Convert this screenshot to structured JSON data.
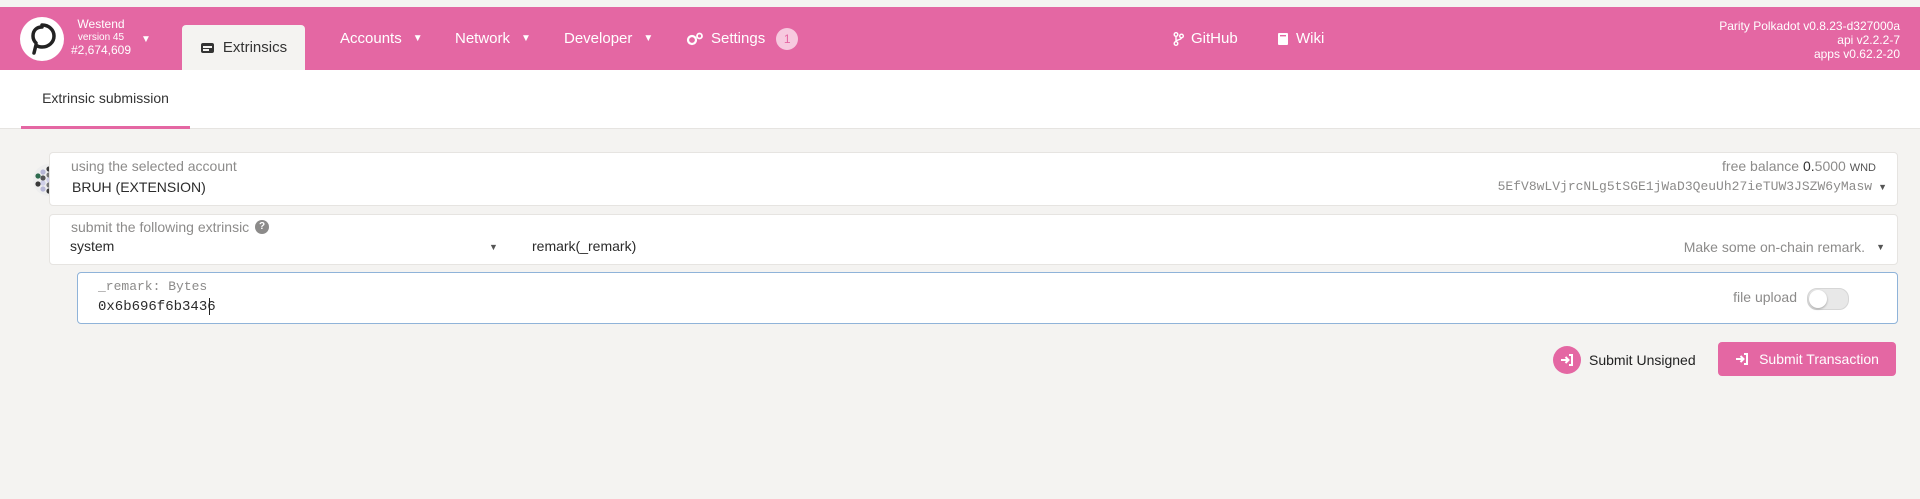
{
  "header": {
    "chain_name": "Westend",
    "chain_version": "version 45",
    "block_number": "#2,674,609",
    "active_tab": "Extrinsics",
    "menu": [
      {
        "label": "Accounts"
      },
      {
        "label": "Network"
      },
      {
        "label": "Developer"
      },
      {
        "label": "Settings",
        "badge": "1"
      }
    ],
    "links": [
      {
        "label": "GitHub"
      },
      {
        "label": "Wiki"
      }
    ],
    "versions": [
      "Parity Polkadot v0.8.23-d327000a",
      "api v2.2.2-7",
      "apps v0.62.2-20"
    ]
  },
  "subnav": {
    "tab": "Extrinsic submission"
  },
  "account": {
    "label": "using the selected account",
    "name": "BRUH (EXTENSION)",
    "balance_label": "free balance",
    "balance_int": "0.",
    "balance_dec": "5000",
    "balance_unit": "WND",
    "address": "5EfV8wLVjrcNLg5tSGE1jWaD3QeuUh27ieTUW3JSZW6yMasw"
  },
  "extrinsic": {
    "label": "submit the following extrinsic",
    "section": "system",
    "method": "remark(_remark)",
    "description": "Make some on-chain remark."
  },
  "param": {
    "label": "_remark: Bytes",
    "value": "0x6b696f6b3436",
    "file_upload_label": "file upload",
    "file_upload_enabled": false
  },
  "actions": {
    "unsigned_label": "Submit Unsigned",
    "submit_label": "Submit Transaction"
  },
  "colors": {
    "accent": "#e467a3",
    "background": "#f4f3f1"
  }
}
